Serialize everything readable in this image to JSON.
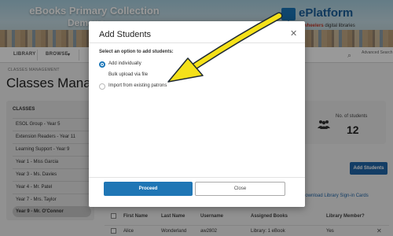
{
  "banner": {
    "title": "eBooks Primary Collection",
    "subtitle": "Demons",
    "logo_name": "ePlatform",
    "logo_tag_brand": "wheelers",
    "logo_tag_rest": " digital libraries"
  },
  "nav": {
    "library": "LIBRARY",
    "browse": "BROWSE",
    "advanced_search": "Advanced Search",
    "search_icon": "search-icon"
  },
  "breadcrumb": "CLASSES MANAGEMENT",
  "page_title": "Classes Managem",
  "classes": {
    "heading": "CLASSES",
    "items": [
      "ESOL Group - Year 5",
      "Extension Readers - Year 11",
      "Learning Support - Year 9",
      "Year 1 - Miss Garcia",
      "Year 3 - Ms. Davies",
      "Year 4 - Mr. Patel",
      "Year 7 - Mrs. Taylor",
      "Year 9 - Mr. O'Connor"
    ],
    "selected_index": 7
  },
  "stats": {
    "label": "No. of students",
    "value": "12"
  },
  "add_students_button": "Add Students",
  "download_link": "Download Library Sign-in Cards",
  "table": {
    "columns": [
      "First Name",
      "Last Name",
      "Username",
      "Assigned Books",
      "Library Member?"
    ],
    "rows": [
      [
        "Alice",
        "Wonderland",
        "aw2802",
        "Library: 1 eBook",
        "Yes"
      ]
    ]
  },
  "modal": {
    "title": "Add Students",
    "prompt": "Select an option to add students:",
    "options": [
      "Add individually",
      "Bulk upload via file",
      "Import from existing patrons"
    ],
    "selected_option": 0,
    "proceed": "Proceed",
    "close": "Close"
  },
  "colors": {
    "primary_button": "#1f76b5",
    "annotation_arrow": "#f5e11a"
  }
}
